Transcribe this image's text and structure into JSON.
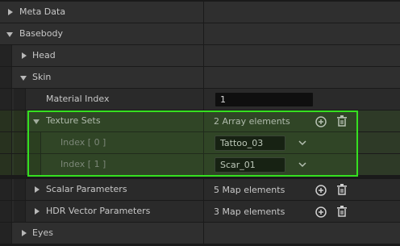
{
  "rows": {
    "meta_data": {
      "label": "Meta Data"
    },
    "basebody": {
      "label": "Basebody"
    },
    "head": {
      "label": "Head"
    },
    "skin": {
      "label": "Skin"
    },
    "material_index": {
      "label": "Material Index",
      "value": "1"
    },
    "texture_sets": {
      "label": "Texture Sets",
      "value": "2 Array elements"
    },
    "index0": {
      "label": "Index [ 0 ]",
      "value": "Tattoo_03"
    },
    "index1": {
      "label": "Index [ 1 ]",
      "value": "Scar_01"
    },
    "scalar_parameters": {
      "label": "Scalar Parameters",
      "value": "5 Map elements"
    },
    "hdr_vector_parameters": {
      "label": "HDR Vector Parameters",
      "value": "3 Map elements"
    },
    "eyes": {
      "label": "Eyes"
    }
  },
  "colors": {
    "highlight": "#35e020",
    "panel": "#2a2a2a",
    "input_bg": "#0f0f0f"
  },
  "icons": [
    "chevron-right-icon",
    "chevron-down-icon",
    "add-circle-icon",
    "trash-icon"
  ]
}
